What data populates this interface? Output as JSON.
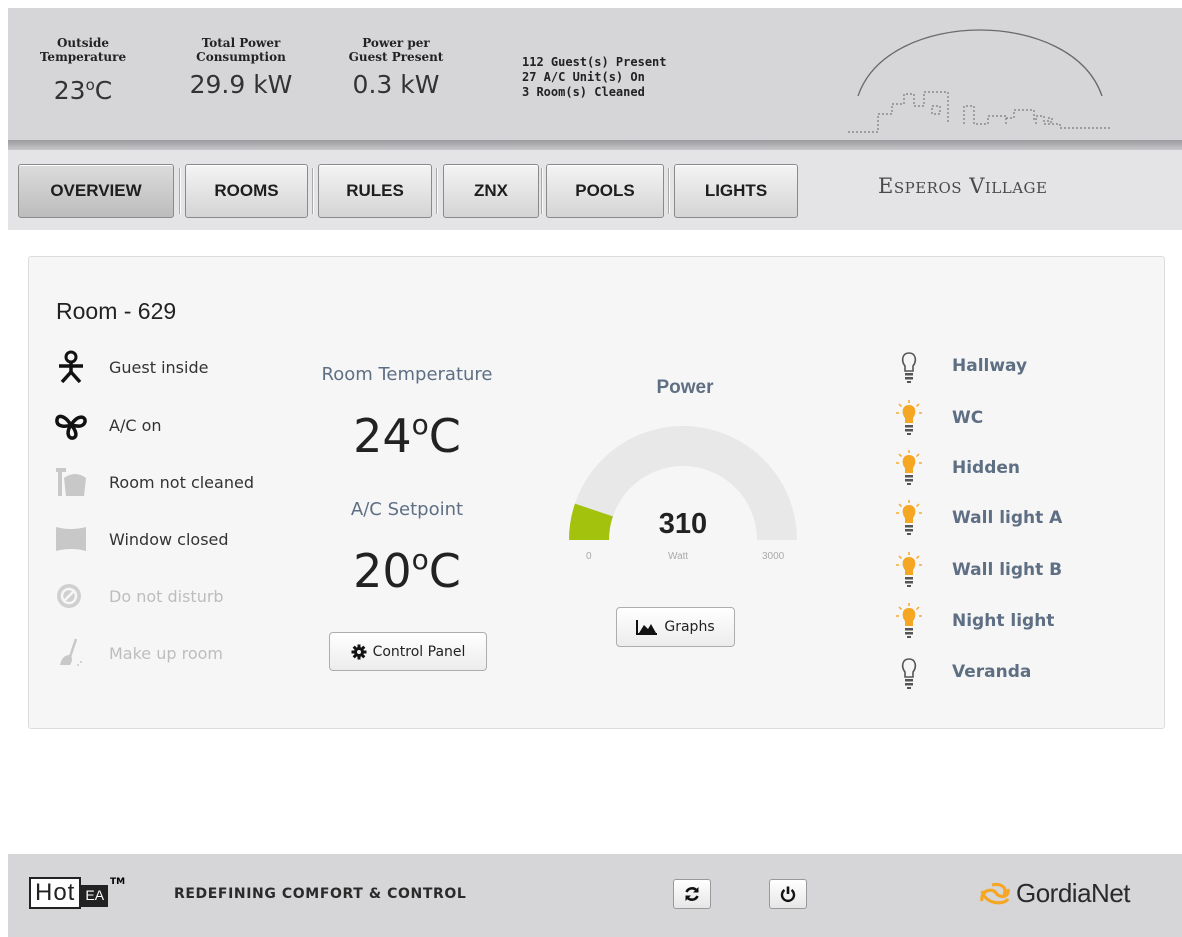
{
  "header": {
    "stats": [
      {
        "label_1": "Outside",
        "label_2": "Temperature",
        "value": "23",
        "unit": "C"
      },
      {
        "label_1": "Total Power",
        "label_2": "Consumption",
        "value": "29.9 kW"
      },
      {
        "label_1": "Power per",
        "label_2": "Guest Present",
        "value": "0.3 kW"
      }
    ],
    "summary": [
      "112 Guest(s) Present",
      "27 A/C Unit(s) On",
      "3 Room(s) Cleaned"
    ]
  },
  "nav": {
    "tabs": [
      "OVERVIEW",
      "ROOMS",
      "RULES",
      "ZNX",
      "POOLS",
      "LIGHTS"
    ],
    "active": "OVERVIEW",
    "site_name": "Esperos Village"
  },
  "room": {
    "title": "Room - 629",
    "statuses": [
      {
        "label": "Guest inside",
        "icon": "person-icon",
        "active": true
      },
      {
        "label": "A/C on",
        "icon": "fan-icon",
        "active": true
      },
      {
        "label": "Room not cleaned",
        "icon": "bucket-icon",
        "active": true
      },
      {
        "label": "Window closed",
        "icon": "window-icon",
        "active": true
      },
      {
        "label": "Do not disturb",
        "icon": "no-entry-icon",
        "active": false
      },
      {
        "label": "Make up room",
        "icon": "broom-icon",
        "active": false
      }
    ],
    "room_temperature_label": "Room Temperature",
    "room_temperature": "24",
    "setpoint_label": "A/C Setpoint",
    "setpoint": "20",
    "temp_unit": "C",
    "control_panel_label": "Control Panel",
    "power": {
      "title": "Power",
      "value": 310,
      "min": 0,
      "max": 3000,
      "unit": "Watt",
      "min_label": "0",
      "max_label": "3000",
      "value_label": "310"
    },
    "graphs_label": "Graphs",
    "lights": [
      {
        "name": "Hallway",
        "on": false
      },
      {
        "name": "WC",
        "on": true
      },
      {
        "name": "Hidden",
        "on": true
      },
      {
        "name": "Wall light A",
        "on": true
      },
      {
        "name": "Wall light B",
        "on": true
      },
      {
        "name": "Night light",
        "on": true
      },
      {
        "name": "Veranda",
        "on": false
      }
    ]
  },
  "footer": {
    "brand_a": "Hot",
    "brand_b": "EA",
    "trademark": "TM",
    "tagline": "REDEFINING COMFORT & CONTROL",
    "vendor": "GordiaNet"
  },
  "colors": {
    "accent_text": "#5e6f84",
    "gauge_fill": "#a3c20e",
    "light_on": "#f5a623",
    "header_bg": "#d6d6d9"
  }
}
